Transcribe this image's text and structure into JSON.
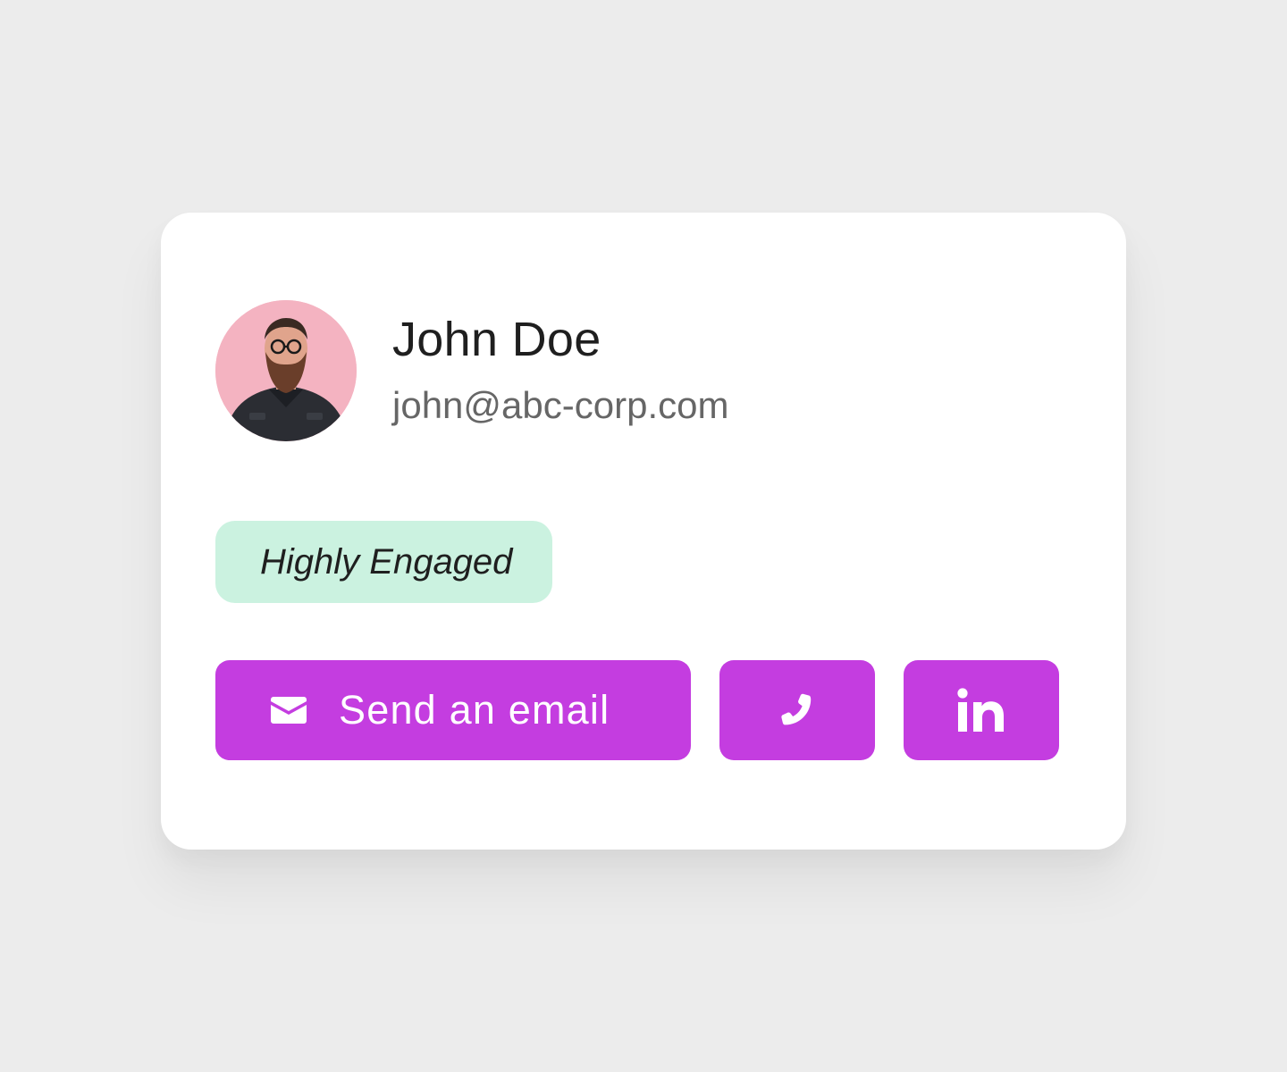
{
  "contact": {
    "name": "John Doe",
    "email": "john@abc-corp.com",
    "badge": "Highly Engaged"
  },
  "actions": {
    "email_button_label": "Send an email",
    "email_icon": "envelope-icon",
    "phone_icon": "phone-icon",
    "linkedin_icon": "linkedin-icon"
  },
  "colors": {
    "accent": "#c43de0",
    "badge_bg": "#cbf2e0",
    "avatar_bg": "#f4b3c1",
    "page_bg": "#ececec"
  }
}
